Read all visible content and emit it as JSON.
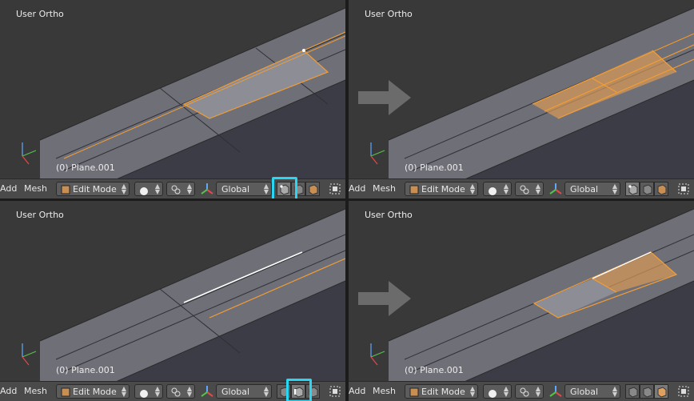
{
  "panels": [
    {
      "view": "User Ortho",
      "object": "(0) Plane.001",
      "menu": [
        "Add",
        "Mesh"
      ],
      "mode": "Edit Mode",
      "orientation": "Global",
      "select_mode": "vertex",
      "arrow": false
    },
    {
      "view": "User Ortho",
      "object": "(0) Plane.001",
      "menu": [
        "Add",
        "Mesh"
      ],
      "mode": "Edit Mode",
      "orientation": "Global",
      "select_mode": "vertex",
      "arrow": true
    },
    {
      "view": "User Ortho",
      "object": "(0) Plane.001",
      "menu": [
        "Add",
        "Mesh"
      ],
      "mode": "Edit Mode",
      "orientation": "Global",
      "select_mode": "edge",
      "arrow": false
    },
    {
      "view": "User Ortho",
      "object": "(0) Plane.001",
      "menu": [
        "Add",
        "Mesh"
      ],
      "mode": "Edit Mode",
      "orientation": "Global",
      "select_mode": "face",
      "arrow": true
    }
  ],
  "colors": {
    "background": "#393939",
    "mesh_top": "#6f6f78",
    "mesh_side": "#3c3c47",
    "selection": "#f29d35",
    "highlight": "#2bd6f2",
    "arrow": "#6b6b6b"
  },
  "icons": [
    "mode-icon",
    "shading-sphere-icon",
    "pivot-icon",
    "transform-manipulator-icon",
    "vertex-select-icon",
    "edge-select-icon",
    "face-select-icon",
    "occlude-icon",
    "big-arrow-icon"
  ]
}
